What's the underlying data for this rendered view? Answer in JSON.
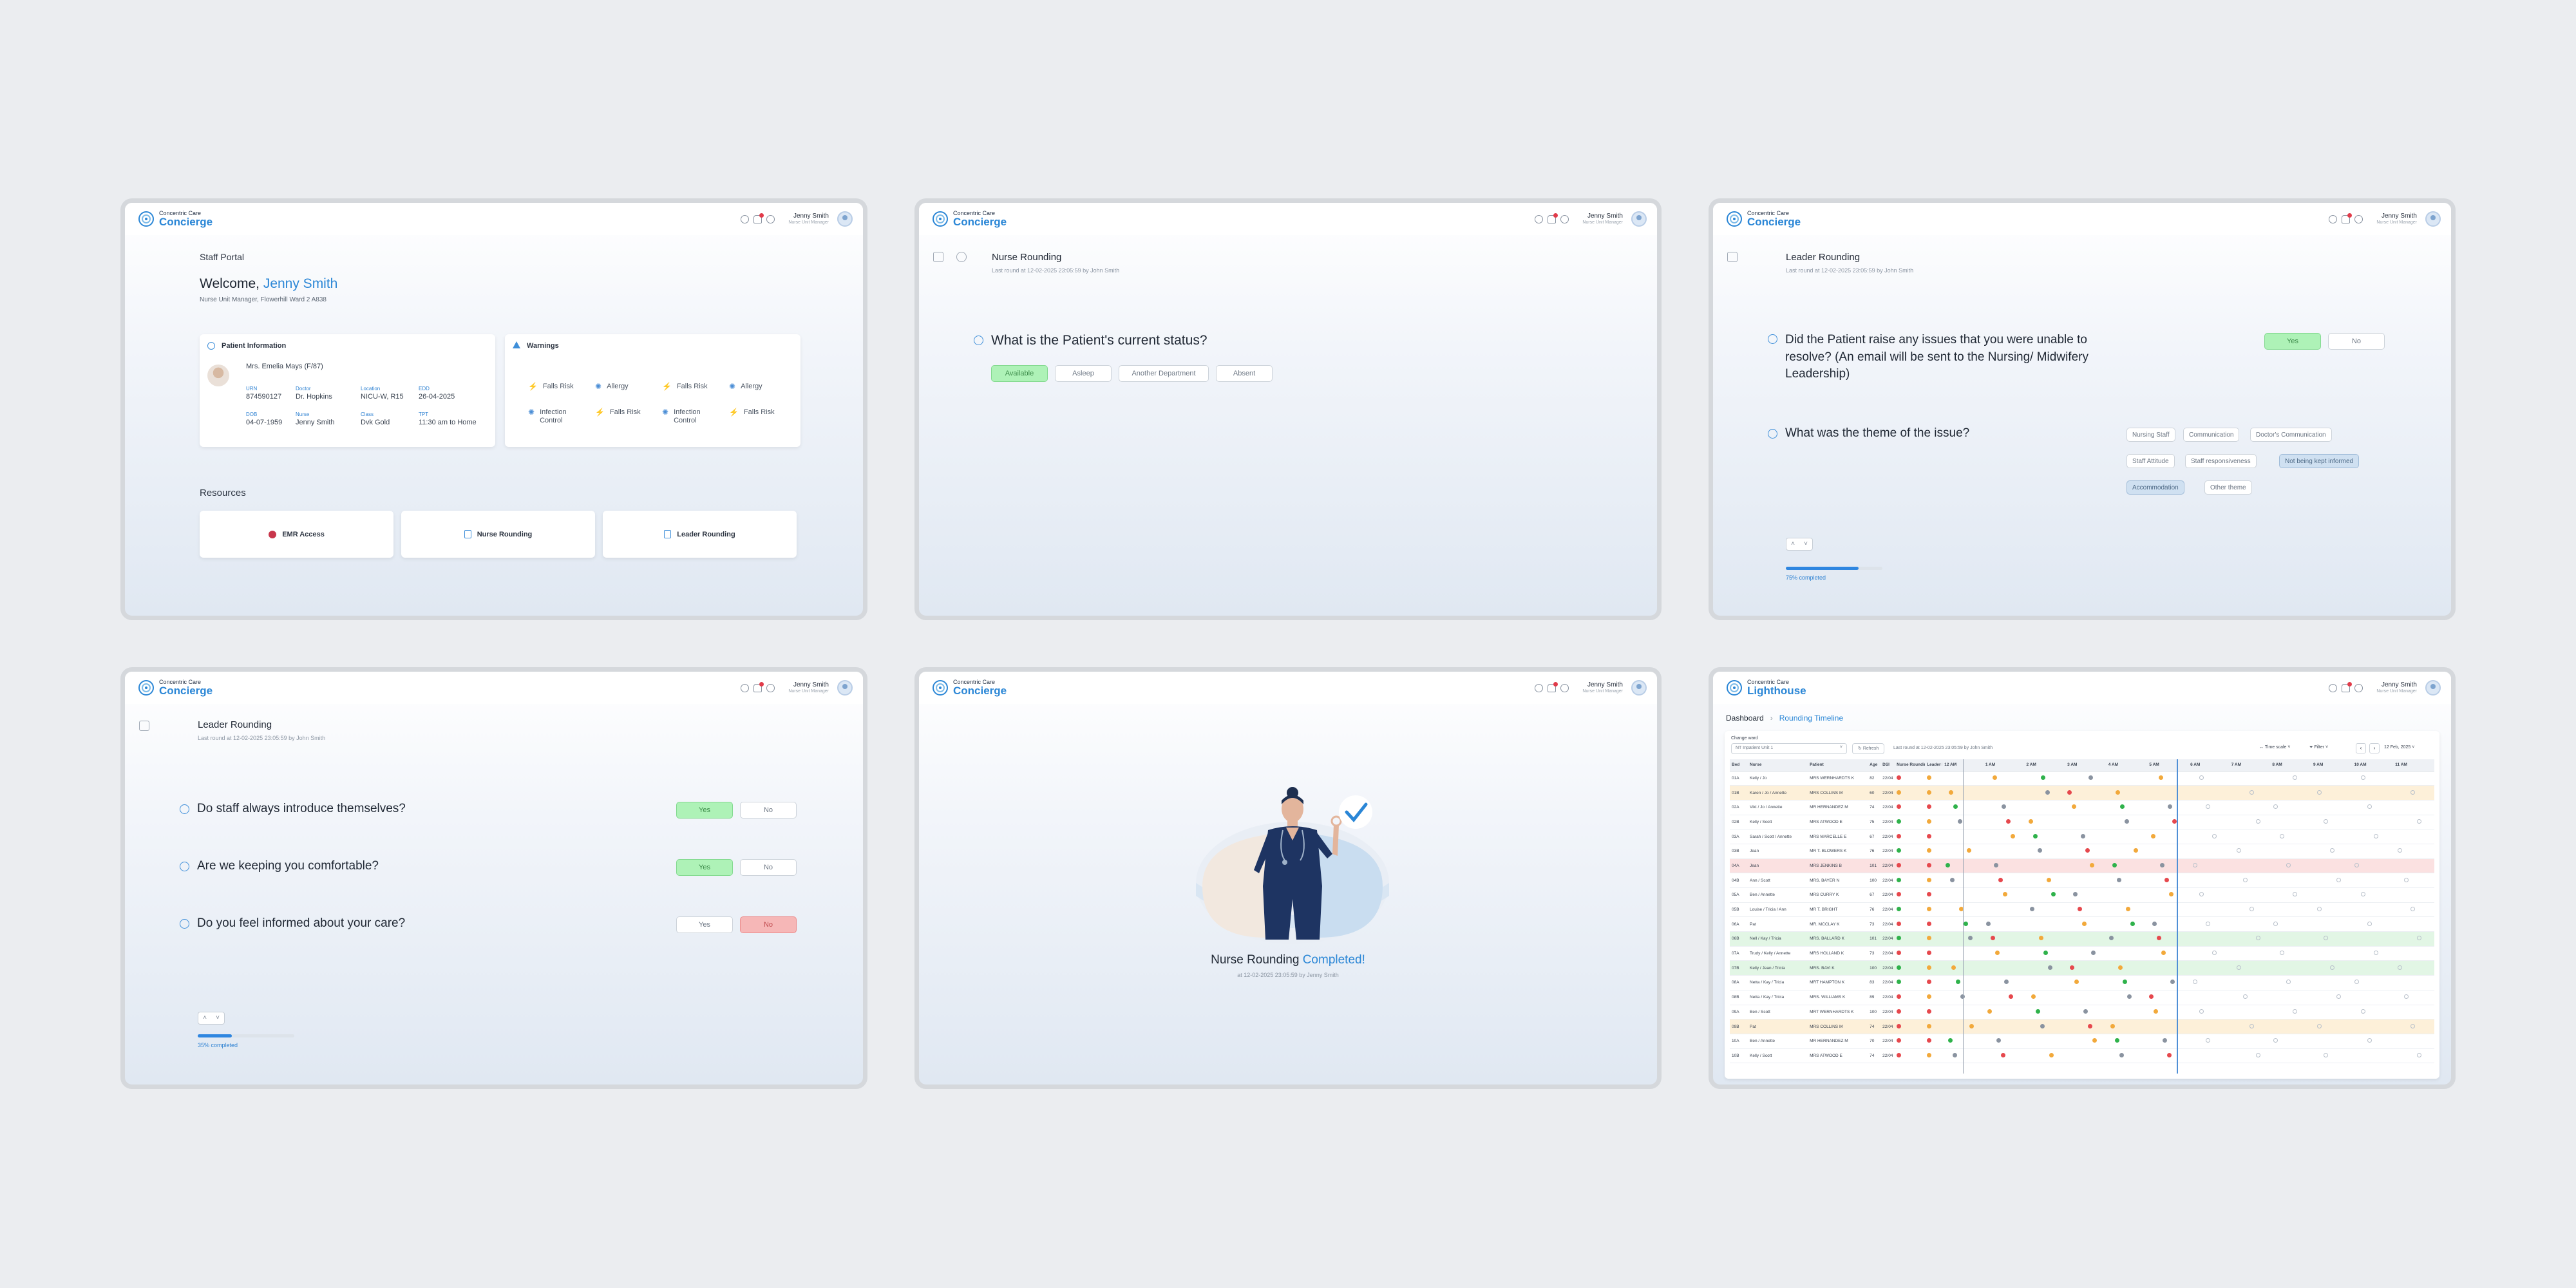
{
  "colors": {
    "accent": "#2a86d6",
    "green": "#aef2b7",
    "red": "#f6b7b7"
  },
  "brand": {
    "top": "Concentric Care",
    "product_concierge": "Concierge",
    "product_lighthouse": "Lighthouse"
  },
  "user": {
    "name": "Jenny Smith",
    "role": "Nurse Unit Manager"
  },
  "p1": {
    "portal": "Staff Portal",
    "welcome_prefix": "Welcome, ",
    "welcome_name": "Jenny Smith",
    "subtitle": "Nurse Unit Manager, Flowerhill Ward 2 A838",
    "patient_title": "Patient Information",
    "patient_name": "Mrs. Emelia Mays (F/87)",
    "fields": [
      {
        "label": "URN",
        "value": "874590127"
      },
      {
        "label": "Doctor",
        "value": "Dr. Hopkins"
      },
      {
        "label": "Location",
        "value": "NICU-W, R15"
      },
      {
        "label": "EDD",
        "value": "26-04-2025"
      },
      {
        "label": "DOB",
        "value": "04-07-1959"
      },
      {
        "label": "Nurse",
        "value": "Jenny Smith"
      },
      {
        "label": "Class",
        "value": "Dvk Gold"
      },
      {
        "label": "TPT",
        "value": "11:30 am to Home"
      }
    ],
    "warnings_title": "Warnings",
    "warnings": [
      "Falls Risk",
      "Allergy",
      "Falls Risk",
      "Allergy",
      "Infection Control",
      "Falls Risk",
      "Infection Control",
      "Falls Risk"
    ],
    "resources_title": "Resources",
    "resources": [
      "EMR Access",
      "Nurse Rounding",
      "Leader Rounding"
    ]
  },
  "p2": {
    "title": "Nurse Rounding",
    "sub": "Last round at 12-02-2025 23:05:59 by John Smith",
    "question": "What is the Patient's current status?",
    "options": [
      "Available",
      "Asleep",
      "Another Department",
      "Absent"
    ]
  },
  "p3": {
    "title": "Leader Rounding",
    "sub": "Last round at 12-02-2025 23:05:59 by John Smith",
    "q1": "Did the Patient raise any issues that you were unable to resolve? (An email will be sent to the Nursing/ Midwifery Leadership)",
    "yes": "Yes",
    "no": "No",
    "q2": "What was the theme of the issue?",
    "themes": [
      "Nursing Staff",
      "Communication",
      "Doctor's Communication",
      "Staff Attitude",
      "Staff responsiveness",
      "Not being kept informed",
      "Accommodation",
      "Other theme"
    ],
    "progress_label": "75% completed",
    "progress": 0.75
  },
  "p4": {
    "title": "Leader Rounding",
    "sub": "Last round at 12-02-2025 23:05:59 by John Smith",
    "questions": [
      "Do staff always introduce themselves?",
      "Are we keeping you comfortable?",
      "Do you feel informed about your care?"
    ],
    "yes": "Yes",
    "no": "No",
    "progress_label": "35% completed",
    "progress": 0.35
  },
  "p5": {
    "title_a": "Nurse Rounding ",
    "title_b": "Completed!",
    "sub": "at 12-02-2025 23:05:59 by Jenny Smith"
  },
  "p6": {
    "crumb_home": "Dashboard",
    "crumb_sep": "›",
    "crumb_current": "Rounding Timeline",
    "ward_label": "Change ward",
    "ward_value": "NT Inpatient Unit 1",
    "refresh": "Refresh",
    "last_round": "Last round at 12-02-2025 23:05:59 by John Smith",
    "timescale": "Time scale",
    "filter": "Filter",
    "date": "12 Feb, 2025",
    "columns": [
      "Bed",
      "Nurse",
      "Patient",
      "Age",
      "DSI",
      "Nurse Rounding",
      "Leader Rounding",
      "12 AM",
      "1 AM",
      "2 AM",
      "3 AM",
      "4 AM",
      "5 AM",
      "6 AM",
      "7 AM",
      "8 AM",
      "9 AM",
      "10 AM",
      "11 AM"
    ],
    "rows": [
      [
        "01A",
        "Kelly / Jo",
        "MRS WERNHARDTS K",
        "82",
        "22/04"
      ],
      [
        "01B",
        "Karen / Jo / Annette",
        "MRS COLLINS M",
        "60",
        "22/04"
      ],
      [
        "02A",
        "Vikt / Jo / Annette",
        "MR HERNANDEZ M",
        "74",
        "22/04"
      ],
      [
        "02B",
        "Kelly / Scott",
        "MRS ATWOOD E",
        "75",
        "22/04"
      ],
      [
        "03A",
        "Sarah / Scott / Annette",
        "MRS MARCELLE E",
        "67",
        "22/04"
      ],
      [
        "03B",
        "Jean",
        "MR T. BLOWERS K",
        "76",
        "22/04"
      ],
      [
        "04A",
        "Jean",
        "MRS JENKINS B",
        "101",
        "22/04"
      ],
      [
        "04B",
        "Ann / Scott",
        "MRS. BAYER N",
        "100",
        "22/04"
      ],
      [
        "05A",
        "Ben / Annette",
        "MRS CURRY K",
        "67",
        "22/04"
      ],
      [
        "05B",
        "Louise / Tricia / Ann",
        "MR T. BRIGHT",
        "76",
        "22/04"
      ],
      [
        "06A",
        "Pat",
        "MR. MCCLAY K",
        "73",
        "22/04"
      ],
      [
        "06B",
        "Nell / Kay / Tricia",
        "MRS. BALLARD K",
        "101",
        "22/04"
      ],
      [
        "07A",
        "Trudy / Kelly / Annette",
        "MRS HOLLAND K",
        "73",
        "22/04"
      ],
      [
        "07B",
        "Kelly / Jean / Tricia",
        "MRS. BAVI K",
        "100",
        "22/04"
      ],
      [
        "08A",
        "Netta / Kay / Tricia",
        "MRT HAMPTON K",
        "83",
        "22/04"
      ],
      [
        "08B",
        "Netta / Kay / Tricia",
        "MRS. WILLIAMS K",
        "89",
        "22/04"
      ],
      [
        "09A",
        "Ben / Scott",
        "MRT WERNHARDTS K",
        "100",
        "22/04"
      ],
      [
        "09B",
        "Pat",
        "MRS COLLINS M",
        "74",
        "22/04"
      ],
      [
        "10A",
        "Ben / Annette",
        "MR HERNANDEZ M",
        "70",
        "22/04"
      ],
      [
        "10B",
        "Kelly / Scott",
        "MRS ATWOOD E",
        "74",
        "22/04"
      ]
    ],
    "row_status": [
      "",
      "amber",
      "",
      "",
      "",
      "",
      "red",
      "",
      "",
      "",
      "",
      "green",
      "",
      "green",
      "",
      "",
      "",
      "amber",
      "",
      ""
    ],
    "leader_colors": [
      "#f2a93b",
      "#f2a93b",
      "#e6484d",
      "#f2a93b",
      "#e6484d",
      "#f2a93b",
      "#e6484d",
      "#f2a93b",
      "#e6484d",
      "#f2a93b",
      "#e6484d",
      "#f2a93b",
      "#e6484d",
      "#f2a93b",
      "#e6484d",
      "#f2a93b",
      "#e6484d",
      "#f2a93b",
      "#e6484d",
      "#f2a93b"
    ],
    "nurse_colors": [
      "#e6484d",
      "#f2a93b",
      "#e6484d",
      "#2fb24b",
      "#e6484d",
      "#2fb24b",
      "#e6484d",
      "#2fb24b",
      "#e6484d",
      "#2fb24b",
      "#e6484d",
      "#2fb24b",
      "#e6484d",
      "#2fb24b",
      "#2fb24b",
      "#e6484d",
      "#e6484d",
      "#e6484d",
      "#e6484d",
      "#e6484d"
    ]
  }
}
